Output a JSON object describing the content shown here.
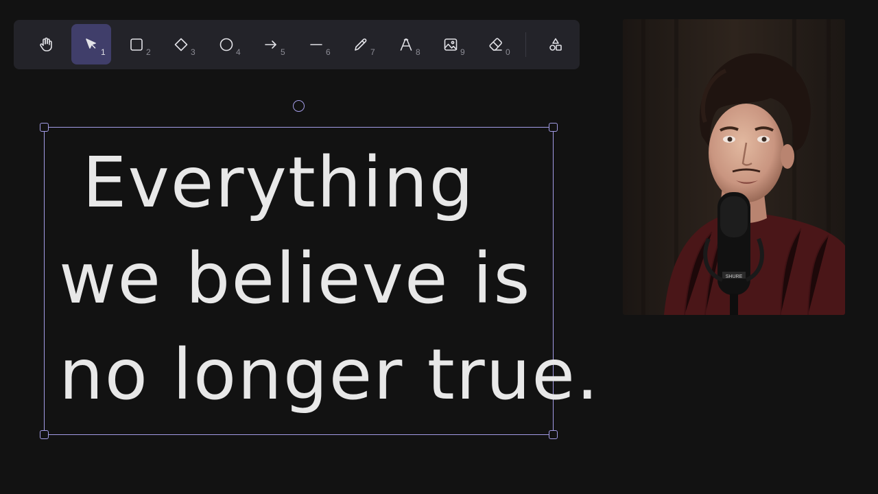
{
  "toolbar": {
    "tools": [
      {
        "name": "hand",
        "key": ""
      },
      {
        "name": "selection",
        "key": "1"
      },
      {
        "name": "rectangle",
        "key": "2"
      },
      {
        "name": "diamond",
        "key": "3"
      },
      {
        "name": "ellipse",
        "key": "4"
      },
      {
        "name": "arrow",
        "key": "5"
      },
      {
        "name": "line",
        "key": "6"
      },
      {
        "name": "draw",
        "key": "7"
      },
      {
        "name": "text",
        "key": "8"
      },
      {
        "name": "image",
        "key": "9"
      },
      {
        "name": "eraser",
        "key": "0"
      },
      {
        "name": "more-tools",
        "key": ""
      }
    ],
    "active_tool": "selection"
  },
  "canvas": {
    "text_lines": [
      "Everything",
      "we believe is",
      "no longer true."
    ]
  },
  "colors": {
    "background": "#121212",
    "toolbar": "#232329",
    "active_tool": "#403e6a",
    "selection": "#a49de8",
    "text": "#e8e8e8"
  },
  "webcam": {
    "mic_label": "SHURE"
  }
}
